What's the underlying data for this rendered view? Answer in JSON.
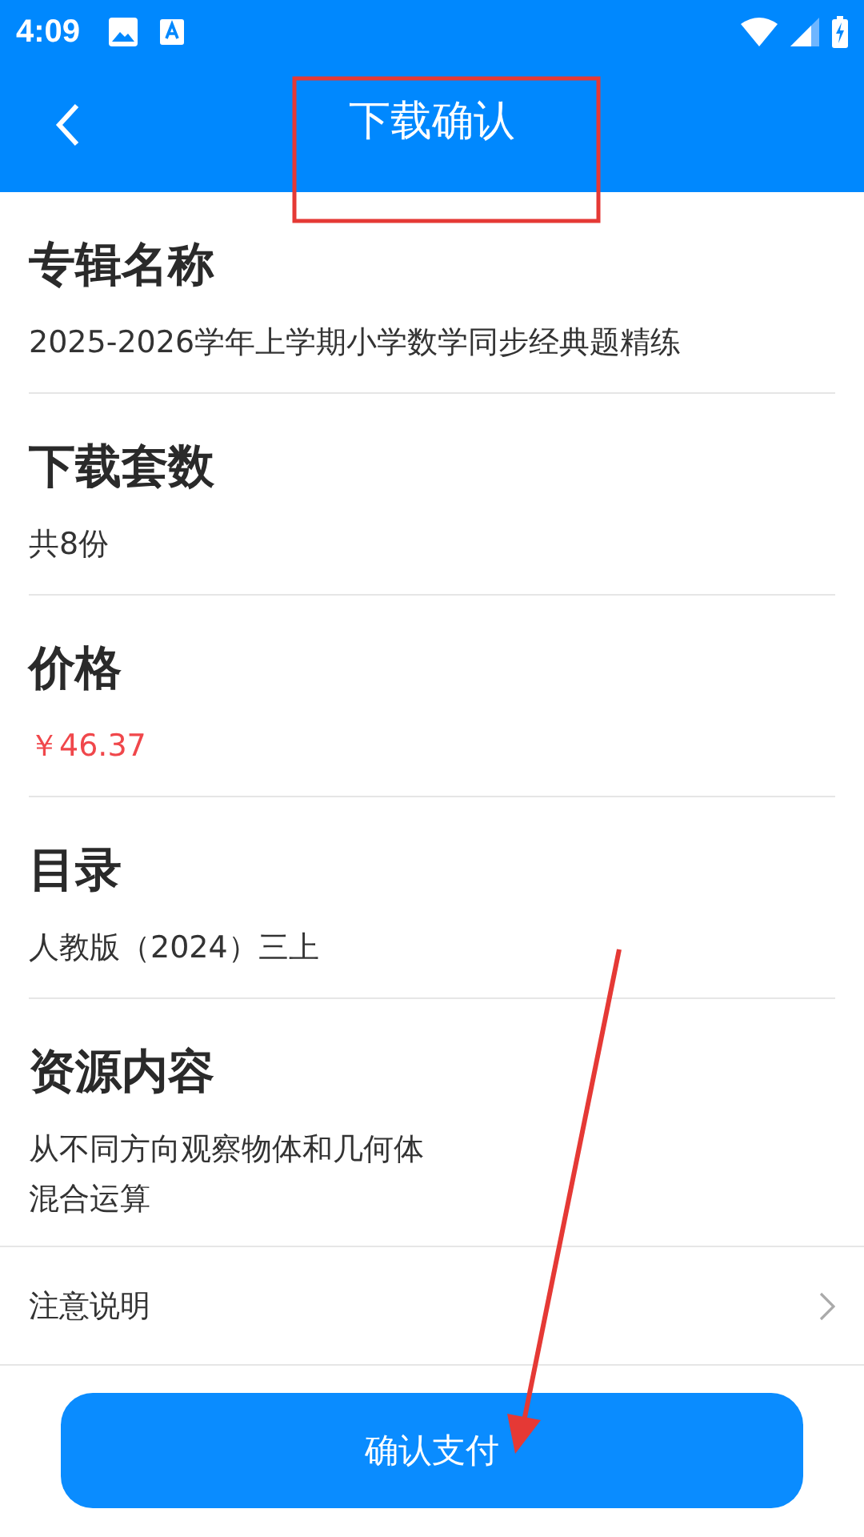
{
  "status_bar": {
    "time": "4:09"
  },
  "header": {
    "title": "下载确认"
  },
  "sections": [
    {
      "heading": "专辑名称",
      "lines": [
        "2025-2026学年上学期小学数学同步经典题精练"
      ],
      "kind": "plain"
    },
    {
      "heading": "下载套数",
      "lines": [
        "共8份"
      ],
      "kind": "plain"
    },
    {
      "heading": "价格",
      "lines": [
        "￥46.37"
      ],
      "kind": "price"
    },
    {
      "heading": "目录",
      "lines": [
        "人教版（2024）三上"
      ],
      "kind": "plain"
    },
    {
      "heading": "资源内容",
      "lines": [
        "从不同方向观察物体和几何体",
        "混合运算"
      ],
      "kind": "plain"
    }
  ],
  "notice_row": {
    "label": "注意说明"
  },
  "pay_button": {
    "label": "确认支付"
  }
}
